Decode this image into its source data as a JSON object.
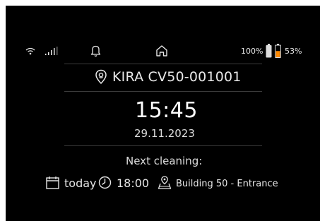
{
  "status_bar": {
    "icons": [
      "wifi-icon",
      "signal-icon",
      "bell-icon",
      "home-icon",
      "battery-full-icon",
      "battery-low-icon"
    ],
    "battery_main_percent": "100%",
    "battery_second_percent": "53%",
    "battery_second_fill_fraction": 0.53,
    "battery_second_color": "#ff8a00"
  },
  "device": {
    "icon": "location-pin-icon",
    "name": "KIRA CV50-001001"
  },
  "clock": {
    "time": "15:45",
    "date": "29.11.2023"
  },
  "next_cleaning": {
    "label": "Next cleaning:",
    "day": "today",
    "time": "18:00",
    "location": "Building 50 - Entrance",
    "icons": [
      "calendar-icon",
      "clock-icon",
      "map-pin-icon"
    ]
  }
}
